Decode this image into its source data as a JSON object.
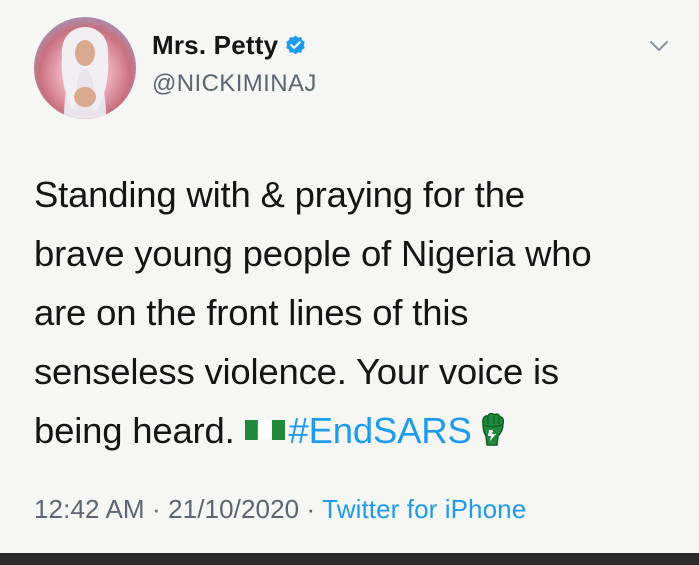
{
  "tweet": {
    "display_name": "Mrs. Petty",
    "handle": "@NICKIMINAJ",
    "text_lines": [
      "Standing with & praying for the",
      "brave young people of Nigeria who",
      "are on the front lines of this",
      "senseless violence. Your voice is",
      "being heard."
    ],
    "hashtag": "#EndSARS",
    "time": "12:42 AM",
    "separator": "·",
    "date": "21/10/2020",
    "source": "Twitter for iPhone"
  },
  "icons": {
    "verified": "verified-badge-icon",
    "menu": "chevron-down-icon",
    "flag": "nigeria-flag-icon",
    "fist": "raised-fist-icon"
  },
  "colors": {
    "link": "#1d9bf0",
    "secondary_text": "#5d6670",
    "flag_green": "#1f8a3c"
  }
}
